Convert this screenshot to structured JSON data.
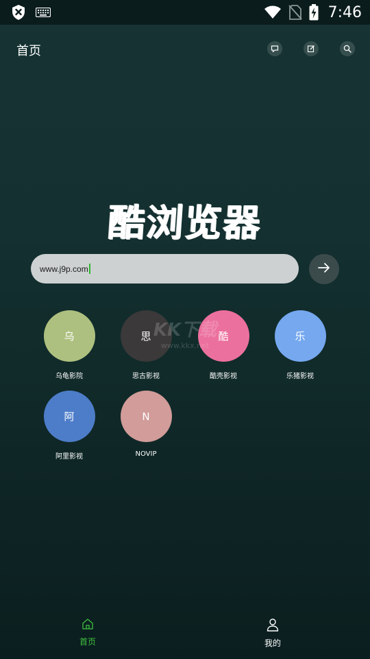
{
  "status_bar": {
    "time": "7:46",
    "left_icons": [
      "shield-x-icon",
      "keyboard-icon"
    ],
    "right_icons": [
      "wifi-icon",
      "no-sim-icon",
      "battery-charging-icon"
    ]
  },
  "header": {
    "title": "首页",
    "actions": [
      "message-icon",
      "edit-icon",
      "search-icon"
    ]
  },
  "logo": {
    "text": "酷浏览器"
  },
  "search": {
    "value": "www.j9p.com",
    "go_icon": "arrow-right-icon"
  },
  "shortcuts": [
    {
      "initial": "乌",
      "label": "乌龟影院",
      "color": "#adc07f"
    },
    {
      "initial": "思",
      "label": "思古影视",
      "color": "#3b3939"
    },
    {
      "initial": "酷",
      "label": "酷壳影视",
      "color": "#ec709d"
    },
    {
      "initial": "乐",
      "label": "乐猪影视",
      "color": "#75a8ef"
    },
    {
      "initial": "阿",
      "label": "阿里影视",
      "color": "#4d7dc9"
    },
    {
      "initial": "N",
      "label": "NOVIP",
      "color": "#d19c99"
    }
  ],
  "watermark": {
    "big": "KK下载",
    "small": "www.kkx.net"
  },
  "bottom_nav": {
    "items": [
      {
        "label": "首页",
        "icon": "home-icon",
        "active": true
      },
      {
        "label": "我的",
        "icon": "user-icon",
        "active": false
      }
    ],
    "active_color": "#3ec13e"
  }
}
